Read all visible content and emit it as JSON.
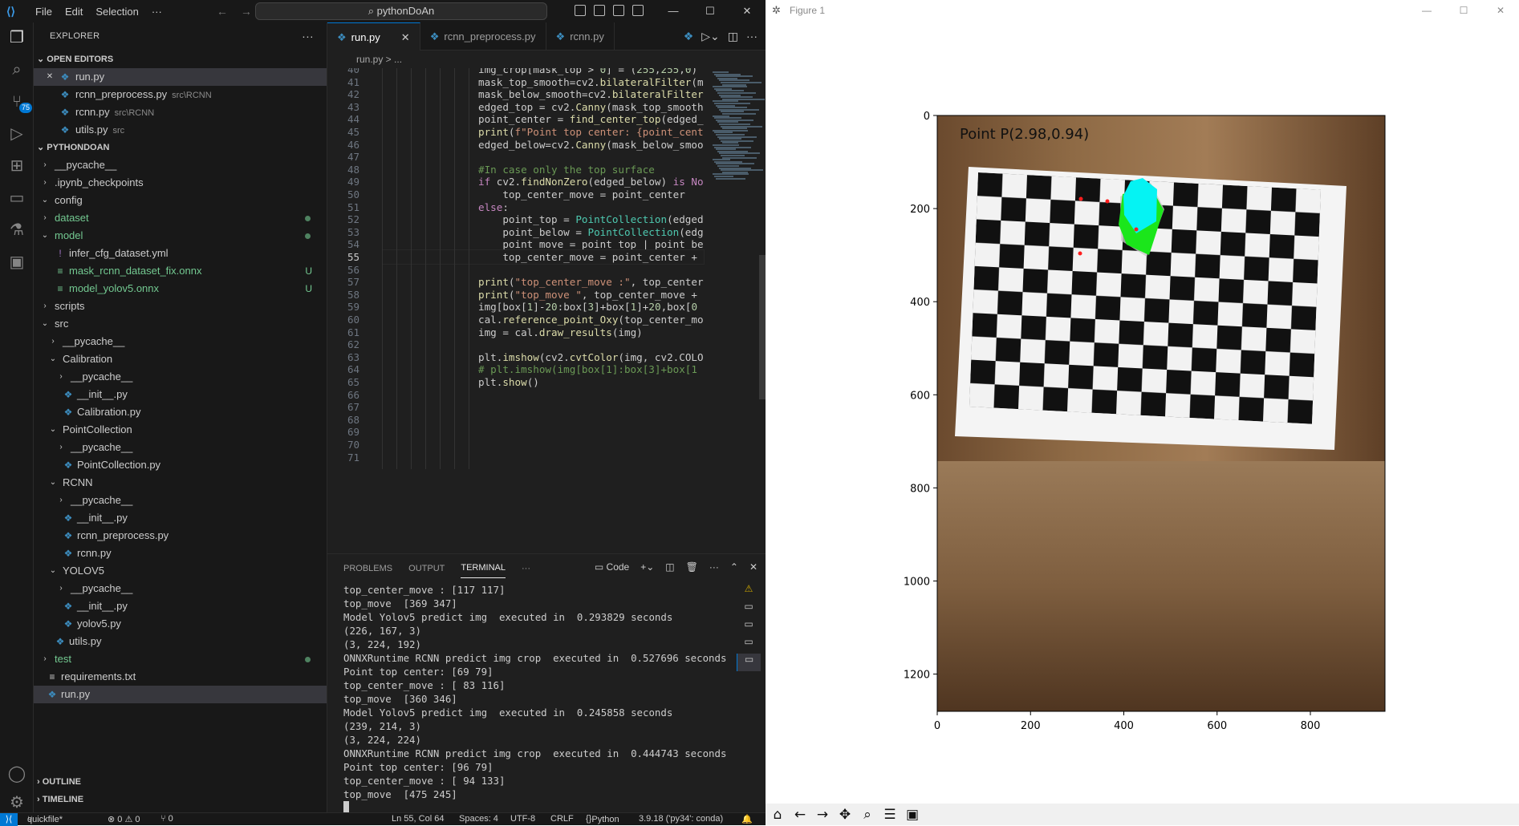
{
  "titlebar": {
    "menus": [
      "File",
      "Edit",
      "Selection",
      "···"
    ],
    "search": "pythonDoAn"
  },
  "activity": {
    "scm_badge": "75"
  },
  "explorer": {
    "title": "EXPLORER",
    "open_editors_header": "OPEN EDITORS",
    "open_editors": [
      {
        "name": "run.py",
        "desc": ""
      },
      {
        "name": "rcnn_preprocess.py",
        "desc": "src\\RCNN"
      },
      {
        "name": "rcnn.py",
        "desc": "src\\RCNN"
      },
      {
        "name": "utils.py",
        "desc": "src"
      }
    ],
    "project_header": "PYTHONDOAN",
    "tree": [
      {
        "name": "__pycache__",
        "depth": 1,
        "type": "folder-closed"
      },
      {
        "name": ".ipynb_checkpoints",
        "depth": 1,
        "type": "folder-closed"
      },
      {
        "name": "config",
        "depth": 1,
        "type": "folder-open"
      },
      {
        "name": "dataset",
        "depth": 1,
        "type": "folder-closed",
        "color": "green",
        "dot": true
      },
      {
        "name": "model",
        "depth": 1,
        "type": "folder-open",
        "color": "green",
        "dot": true
      },
      {
        "name": "infer_cfg_dataset.yml",
        "depth": 2,
        "type": "yml"
      },
      {
        "name": "mask_rcnn_dataset_fix.onnx",
        "depth": 2,
        "type": "onnx",
        "status": "U"
      },
      {
        "name": "model_yolov5.onnx",
        "depth": 2,
        "type": "onnx",
        "status": "U"
      },
      {
        "name": "scripts",
        "depth": 1,
        "type": "folder-closed"
      },
      {
        "name": "src",
        "depth": 1,
        "type": "folder-open"
      },
      {
        "name": "__pycache__",
        "depth": 2,
        "type": "folder-closed"
      },
      {
        "name": "Calibration",
        "depth": 2,
        "type": "folder-open"
      },
      {
        "name": "__pycache__",
        "depth": 3,
        "type": "folder-closed"
      },
      {
        "name": "__init__.py",
        "depth": 3,
        "type": "py"
      },
      {
        "name": "Calibration.py",
        "depth": 3,
        "type": "py"
      },
      {
        "name": "PointCollection",
        "depth": 2,
        "type": "folder-open"
      },
      {
        "name": "__pycache__",
        "depth": 3,
        "type": "folder-closed"
      },
      {
        "name": "PointCollection.py",
        "depth": 3,
        "type": "py"
      },
      {
        "name": "RCNN",
        "depth": 2,
        "type": "folder-open"
      },
      {
        "name": "__pycache__",
        "depth": 3,
        "type": "folder-closed"
      },
      {
        "name": "__init__.py",
        "depth": 3,
        "type": "py"
      },
      {
        "name": "rcnn_preprocess.py",
        "depth": 3,
        "type": "py"
      },
      {
        "name": "rcnn.py",
        "depth": 3,
        "type": "py"
      },
      {
        "name": "YOLOV5",
        "depth": 2,
        "type": "folder-open"
      },
      {
        "name": "__pycache__",
        "depth": 3,
        "type": "folder-closed"
      },
      {
        "name": "__init__.py",
        "depth": 3,
        "type": "py"
      },
      {
        "name": "yolov5.py",
        "depth": 3,
        "type": "py"
      },
      {
        "name": "utils.py",
        "depth": 2,
        "type": "py"
      },
      {
        "name": "test",
        "depth": 1,
        "type": "folder-closed",
        "color": "green",
        "dot": true
      },
      {
        "name": "requirements.txt",
        "depth": 1,
        "type": "txt"
      },
      {
        "name": "run.py",
        "depth": 1,
        "type": "py",
        "selected": true
      }
    ],
    "outline": "OUTLINE",
    "timeline": "TIMELINE"
  },
  "editor": {
    "tabs": [
      "run.py",
      "rcnn_preprocess.py",
      "rcnn.py"
    ],
    "breadcrumb": "run.py > ...",
    "current_line": 55,
    "lines": [
      {
        "n": 40,
        "t": "img_crop[mask_top > 0] = (255,255,0)"
      },
      {
        "n": 41,
        "t": "mask_top_smooth=cv2.bilateralFilter(m"
      },
      {
        "n": 42,
        "t": "mask_below_smooth=cv2.bilateralFilter"
      },
      {
        "n": 43,
        "t": "edged_top = cv2.Canny(mask_top_smooth"
      },
      {
        "n": 44,
        "t": "point_center = find_center_top(edged_"
      },
      {
        "n": 45,
        "t": "print(f\"Point top center: {point_cent"
      },
      {
        "n": 46,
        "t": "edged_below=cv2.Canny(mask_below_smoo"
      },
      {
        "n": 47,
        "t": ""
      },
      {
        "n": 48,
        "t": "#In case only the top surface"
      },
      {
        "n": 49,
        "t": "if cv2.findNonZero(edged_below) is No"
      },
      {
        "n": 50,
        "t": "    top_center_move = point_center"
      },
      {
        "n": 51,
        "t": "else:"
      },
      {
        "n": 52,
        "t": "    point_top = PointCollection(edged"
      },
      {
        "n": 53,
        "t": "    point_below = PointCollection(edg"
      },
      {
        "n": 54,
        "t": "    point_move = point_top | point_be"
      },
      {
        "n": 55,
        "t": "    top_center_move = point_center + "
      },
      {
        "n": 56,
        "t": ""
      },
      {
        "n": 57,
        "t": "print(\"top_center_move :\", top_center"
      },
      {
        "n": 58,
        "t": "print(\"top_move \", top_center_move + "
      },
      {
        "n": 59,
        "t": "img[box[1]-20:box[3]+box[1]+20,box[0"
      },
      {
        "n": 60,
        "t": "cal.reference_point_Oxy(top_center_mo"
      },
      {
        "n": 61,
        "t": "img = cal.draw_results(img)"
      },
      {
        "n": 62,
        "t": ""
      },
      {
        "n": 63,
        "t": "plt.imshow(cv2.cvtColor(img, cv2.COLO"
      },
      {
        "n": 64,
        "t": "# plt.imshow(img[box[1]:box[3]+box[1"
      },
      {
        "n": 65,
        "t": "plt.show()"
      },
      {
        "n": 66,
        "t": ""
      },
      {
        "n": 67,
        "t": ""
      },
      {
        "n": 68,
        "t": ""
      },
      {
        "n": 69,
        "t": ""
      },
      {
        "n": 70,
        "t": ""
      },
      {
        "n": 71,
        "t": ""
      }
    ]
  },
  "panel": {
    "tabs": [
      "PROBLEMS",
      "OUTPUT",
      "TERMINAL",
      "···"
    ],
    "active_tab": "TERMINAL",
    "terminal_profile": "Code",
    "terminal_lines": [
      "top_center_move : [117 117]",
      "top_move  [369 347]",
      "Model Yolov5 predict img  executed in  0.293829 seconds",
      "(226, 167, 3)",
      "(3, 224, 192)",
      "ONNXRuntime RCNN predict img crop  executed in  0.527696 seconds",
      "Point top center: [69 79]",
      "top_center_move : [ 83 116]",
      "top_move  [360 346]",
      "Model Yolov5 predict img  executed in  0.245858 seconds",
      "(239, 214, 3)",
      "(3, 224, 224)",
      "ONNXRuntime RCNN predict img crop  executed in  0.444743 seconds",
      "Point top center: [96 79]",
      "top_center_move : [ 94 133]",
      "top_move  [475 245]"
    ]
  },
  "statusbar": {
    "branch": "quickfile*",
    "problems": "⊗ 0 ⚠ 0",
    "ports": "⑂ 0",
    "position": "Ln 55, Col 64",
    "spaces": "Spaces: 4",
    "encoding": "UTF-8",
    "eol": "CRLF",
    "language": "Python",
    "interpreter": "3.9.18 ('py34': conda)"
  },
  "figure": {
    "window_title": "Figure 1",
    "annotation": "Point  P(2.98,0.94)",
    "x_ticks": [
      "0",
      "200",
      "400",
      "600",
      "800"
    ],
    "y_ticks": [
      "0",
      "200",
      "400",
      "600",
      "800",
      "1000",
      "1200"
    ],
    "colors": {
      "cyan": "#00f5f5",
      "green": "#19e619",
      "wood": "#8a6a4a"
    }
  }
}
